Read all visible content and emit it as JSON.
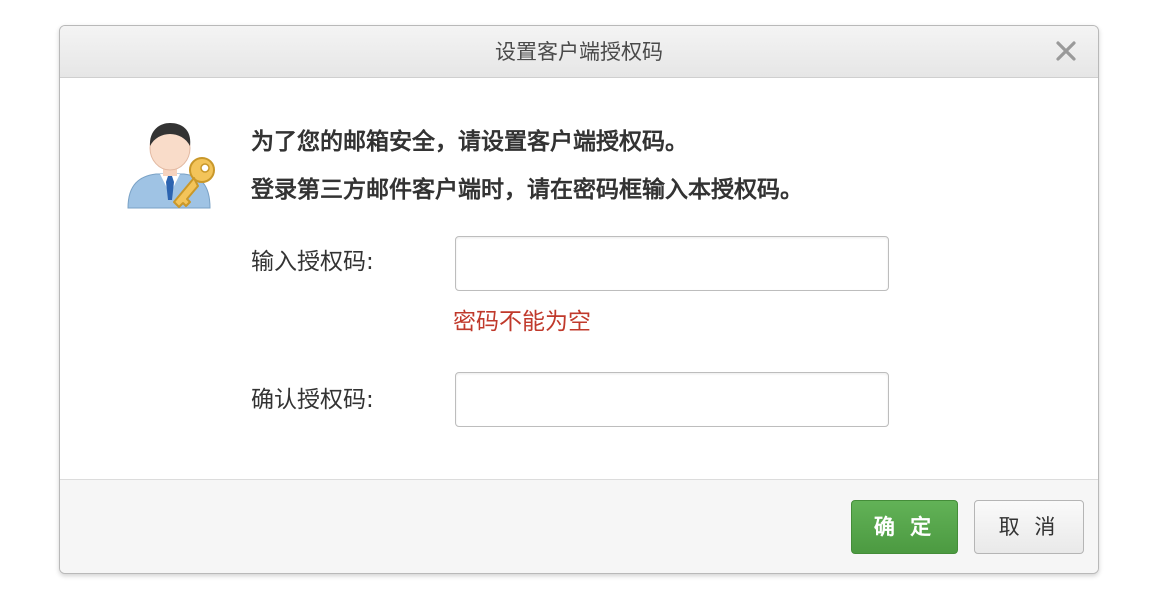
{
  "dialog": {
    "title": "设置客户端授权码",
    "close_icon": "close-icon"
  },
  "message": {
    "line1": "为了您的邮箱安全，请设置客户端授权码。",
    "line2": "登录第三方邮件客户端时，请在密码框输入本授权码。",
    "icon": "user-key-icon"
  },
  "form": {
    "code_label": "输入授权码:",
    "code_value": "",
    "error_text": "密码不能为空",
    "confirm_label": "确认授权码:",
    "confirm_value": ""
  },
  "footer": {
    "ok_label": "确 定",
    "cancel_label": "取 消"
  },
  "colors": {
    "ok_button": "#54a449",
    "error_text": "#c0392b"
  }
}
